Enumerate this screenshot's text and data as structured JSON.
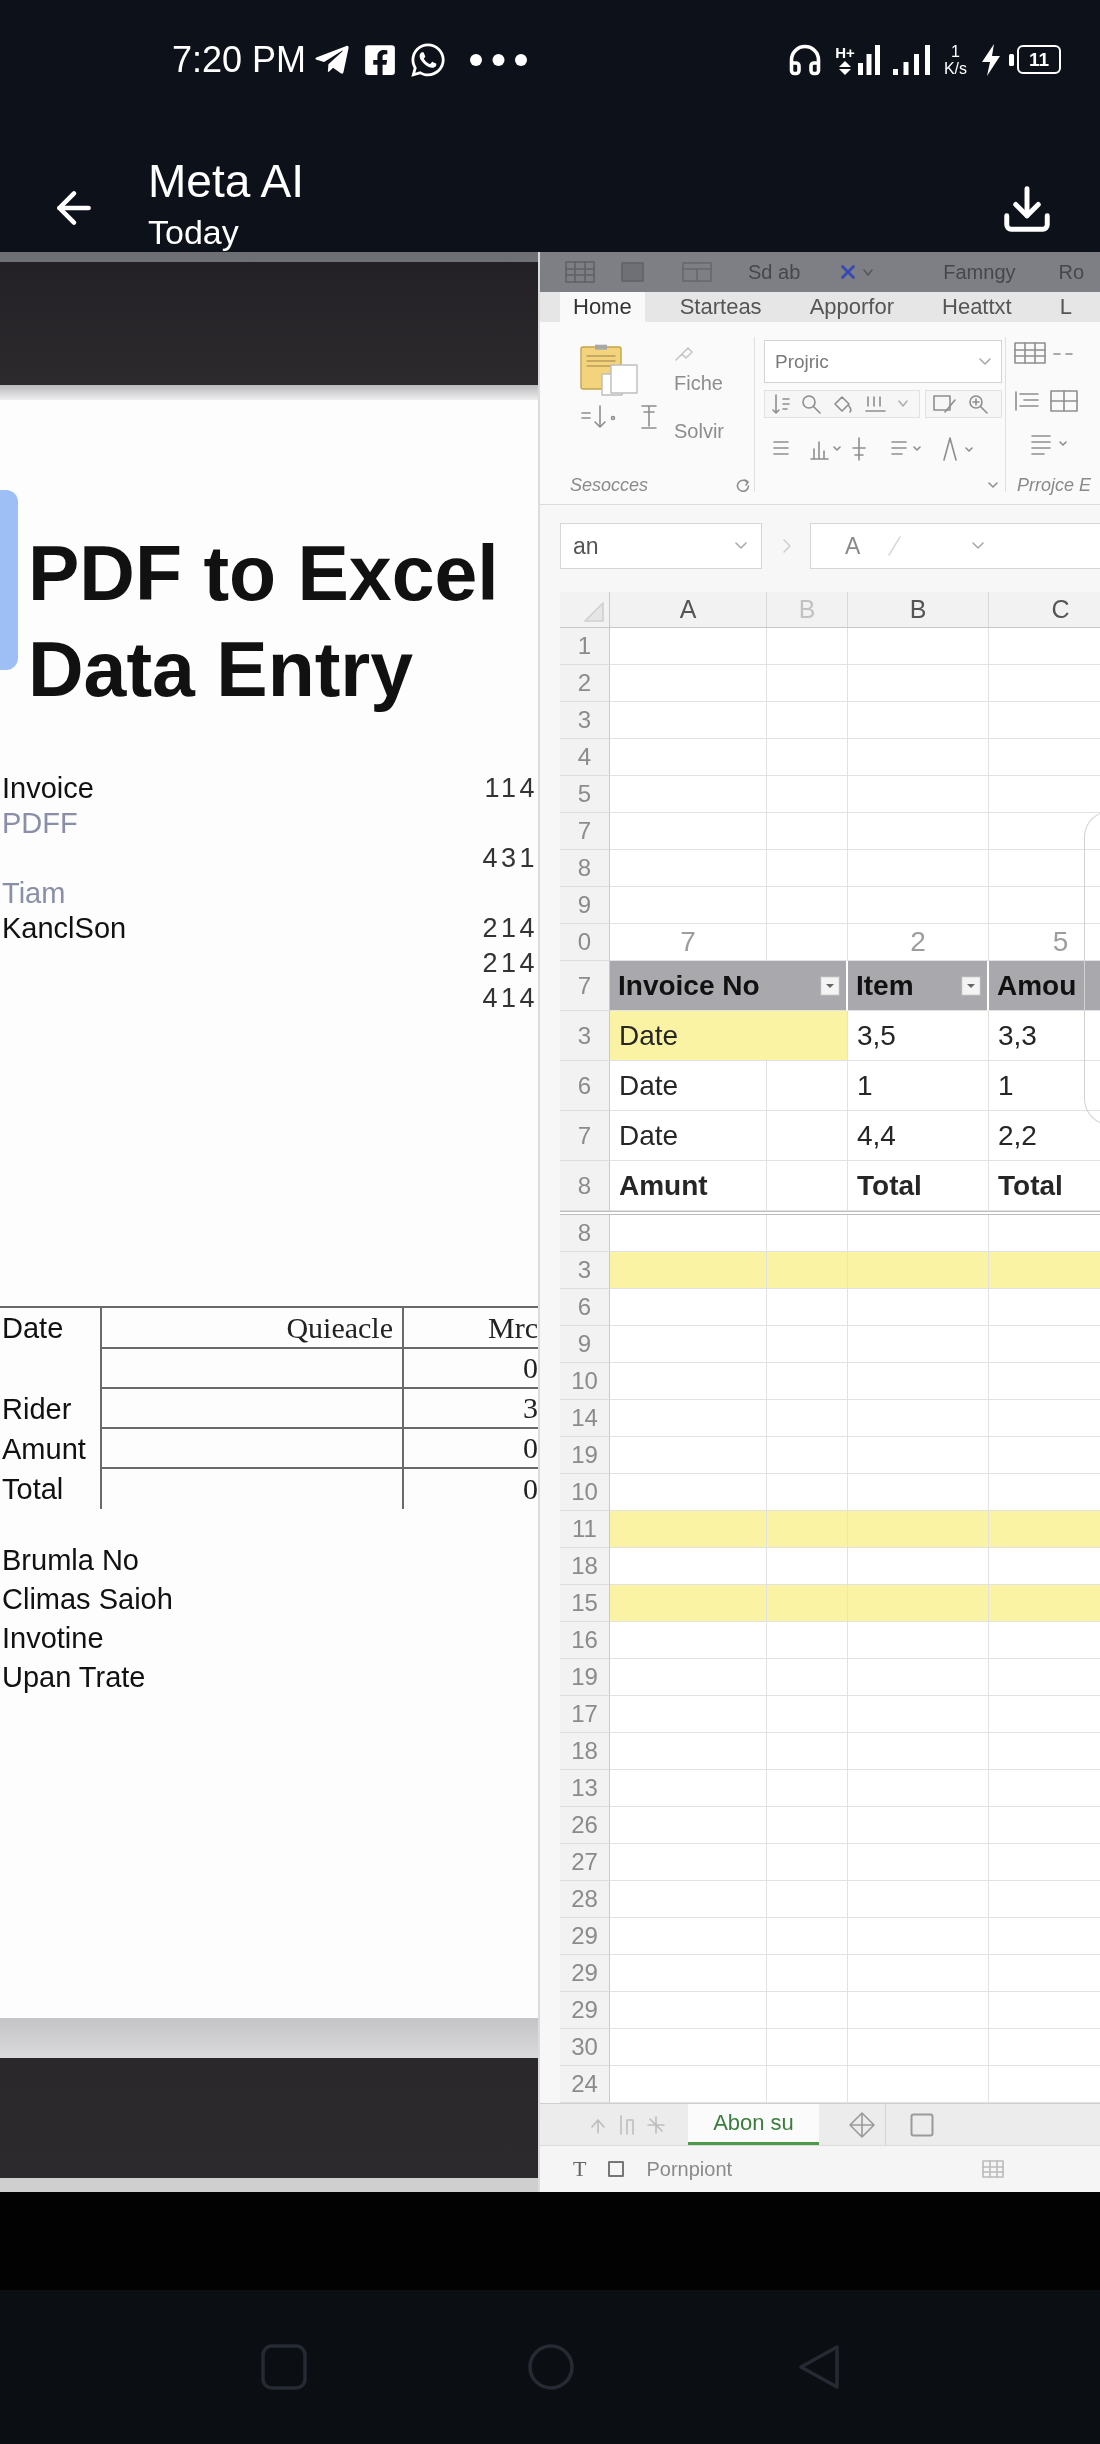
{
  "status_bar": {
    "time": "7:20 PM",
    "network_type": "H+",
    "speed_value": "1",
    "speed_unit": "K/s",
    "battery": "11"
  },
  "app_bar": {
    "title": "Meta AI",
    "subtitle": "Today"
  },
  "document": {
    "title": "PDF to Excel Data Entry",
    "lines": [
      {
        "label": "Invoice",
        "value": "114",
        "faded": false
      },
      {
        "label": "PDFF",
        "faded": true
      },
      {
        "value": "431",
        "faded": false
      },
      {
        "label": "Tiam",
        "faded": true
      },
      {
        "label": "KanclSon",
        "value": "214",
        "faded": false
      },
      {
        "value": "214",
        "faded": false
      },
      {
        "value": "414",
        "faded": false
      }
    ],
    "table": {
      "columns": [
        "Date",
        "Quieacle",
        "Mrc"
      ],
      "rows": [
        {
          "value": "0"
        },
        {
          "label": "Rider",
          "value": "3"
        },
        {
          "label": "Amunt",
          "value": "0"
        },
        {
          "label": "Total",
          "value": "0"
        }
      ]
    },
    "notes": [
      "Brumla No",
      "Climas Saioh",
      "Invotine",
      "Upan Trate"
    ]
  },
  "spreadsheet": {
    "quick_access": [
      "Sd ab",
      "Famngy",
      "Ro"
    ],
    "ribbon_tabs": [
      {
        "label": "Home",
        "selected": true
      },
      {
        "label": "Starteas",
        "selected": false
      },
      {
        "label": "Apporfor",
        "selected": false
      },
      {
        "label": "Heattxt",
        "selected": false
      },
      {
        "label": "L",
        "selected": false
      }
    ],
    "clipboard_labels": [
      "Fiche",
      "Solvir"
    ],
    "font_box": "Projric",
    "group_labels": [
      "Sesocces",
      "Prrojce E"
    ],
    "name_box": "an",
    "formula": "A",
    "columns": [
      {
        "label": "A",
        "faded": false
      },
      {
        "label": "B",
        "faded": true
      },
      {
        "label": "B",
        "faded": false
      },
      {
        "label": "C",
        "faded": false
      }
    ],
    "rows": [
      {
        "number": "1",
        "kind": "blank",
        "highlighted": false
      },
      {
        "number": "2",
        "kind": "blank",
        "highlighted": false
      },
      {
        "number": "3",
        "kind": "blank",
        "highlighted": false
      },
      {
        "number": "4",
        "kind": "blank",
        "highlighted": false
      },
      {
        "number": "5",
        "kind": "blank",
        "highlighted": false
      },
      {
        "number": "7",
        "kind": "blank",
        "highlighted": false
      },
      {
        "number": "8",
        "kind": "blank",
        "highlighted": false
      },
      {
        "number": "9",
        "kind": "blank",
        "highlighted": false
      },
      {
        "number": "0",
        "kind": "index",
        "highlighted": false,
        "cells": [
          "7",
          "2",
          "5"
        ]
      },
      {
        "number": "7",
        "kind": "header",
        "highlighted": false,
        "cells": [
          "Invoice No",
          "Item",
          "Amou"
        ]
      },
      {
        "number": "3",
        "kind": "data",
        "highlighted": true,
        "cells": [
          "Date",
          "3,5",
          "3,3"
        ]
      },
      {
        "number": "6",
        "kind": "data",
        "highlighted": false,
        "cells": [
          "Date",
          "1",
          "1"
        ]
      },
      {
        "number": "7",
        "kind": "data",
        "highlighted": false,
        "cells": [
          "Date",
          "4,4",
          "2,2"
        ]
      },
      {
        "number": "8",
        "kind": "total",
        "highlighted": false,
        "cells": [
          "Amunt",
          "Total",
          "Total"
        ]
      },
      {
        "number": "8",
        "kind": "blank",
        "highlighted": false
      },
      {
        "number": "3",
        "kind": "blank",
        "highlighted": true
      },
      {
        "number": "6",
        "kind": "blank",
        "highlighted": false
      },
      {
        "number": "9",
        "kind": "blank",
        "highlighted": false
      },
      {
        "number": "10",
        "kind": "blank",
        "highlighted": false
      },
      {
        "number": "14",
        "kind": "blank",
        "highlighted": false
      },
      {
        "number": "19",
        "kind": "blank",
        "highlighted": false
      },
      {
        "number": "10",
        "kind": "blank",
        "highlighted": false
      },
      {
        "number": "11",
        "kind": "blank",
        "highlighted": true
      },
      {
        "number": "18",
        "kind": "blank",
        "highlighted": false
      },
      {
        "number": "15",
        "kind": "blank",
        "highlighted": true
      },
      {
        "number": "16",
        "kind": "blank",
        "highlighted": false
      },
      {
        "number": "19",
        "kind": "blank",
        "highlighted": false
      },
      {
        "number": "17",
        "kind": "blank",
        "highlighted": false
      },
      {
        "number": "18",
        "kind": "blank",
        "highlighted": false
      },
      {
        "number": "13",
        "kind": "blank",
        "highlighted": false
      },
      {
        "number": "26",
        "kind": "blank",
        "highlighted": false
      },
      {
        "number": "27",
        "kind": "blank",
        "highlighted": false
      },
      {
        "number": "28",
        "kind": "blank",
        "highlighted": false
      },
      {
        "number": "29",
        "kind": "blank",
        "highlighted": false
      },
      {
        "number": "29",
        "kind": "blank",
        "highlighted": false
      },
      {
        "number": "29",
        "kind": "blank",
        "highlighted": false
      },
      {
        "number": "30",
        "kind": "blank",
        "highlighted": false
      },
      {
        "number": "24",
        "kind": "blank",
        "highlighted": false
      }
    ],
    "sheet_tabs": [
      {
        "label": "Abon su",
        "selected": true
      }
    ],
    "status": {
      "letter": "T",
      "text": "Pornpiont"
    }
  }
}
